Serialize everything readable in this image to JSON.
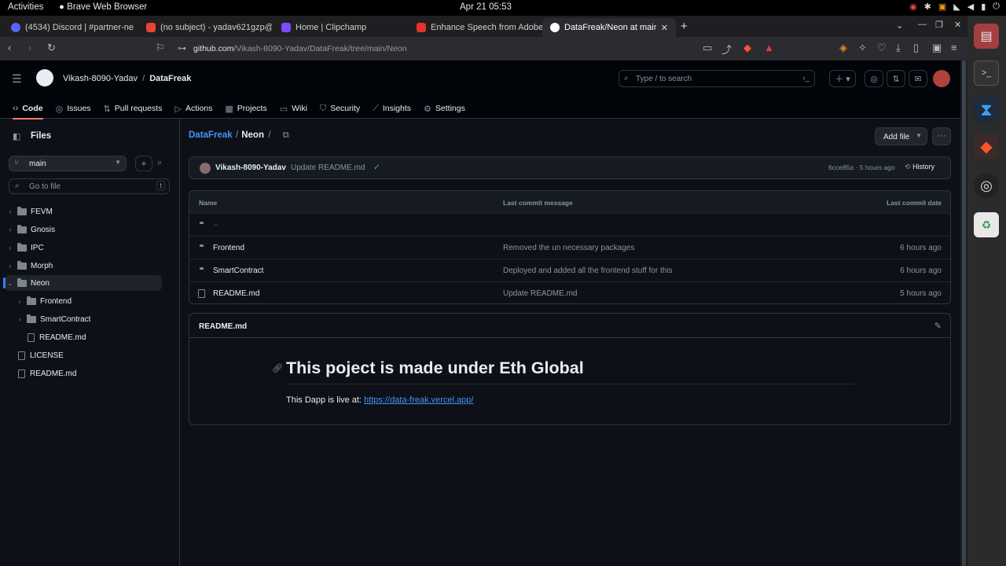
{
  "os": {
    "activities": "Activities",
    "app_name": "Brave Web Browser",
    "clock": "Apr 21  05:53"
  },
  "browser": {
    "tabs": [
      {
        "label": "(4534) Discord | #partner-ne",
        "icon_color": "#5865f2"
      },
      {
        "label": "(no subject) - yadav621gzp@",
        "icon_color": "#ea4335"
      },
      {
        "label": "Home | Clipchamp",
        "icon_color": "#7c4dff"
      },
      {
        "label": "Enhance Speech from Adobe",
        "icon_color": "#e5322d"
      },
      {
        "label": "DataFreak/Neon at main",
        "icon_color": "#ffffff"
      }
    ],
    "url_host": "github.com",
    "url_path": "/Vikash-8090-Yadav/DataFreak/tree/main/Neon"
  },
  "github": {
    "owner": "Vikash-8090-Yadav",
    "separator": "/",
    "repo": "DataFreak",
    "search_placeholder": "Type / to search",
    "nav": [
      {
        "label": "Code",
        "icon": "code-icon"
      },
      {
        "label": "Issues",
        "icon": "issue-icon"
      },
      {
        "label": "Pull requests",
        "icon": "pr-icon"
      },
      {
        "label": "Actions",
        "icon": "play-icon"
      },
      {
        "label": "Projects",
        "icon": "table-icon"
      },
      {
        "label": "Wiki",
        "icon": "book-icon"
      },
      {
        "label": "Security",
        "icon": "shield-icon"
      },
      {
        "label": "Insights",
        "icon": "graph-icon"
      },
      {
        "label": "Settings",
        "icon": "gear-icon"
      }
    ]
  },
  "sidebar": {
    "title": "Files",
    "branch": "main",
    "go_to_file": "Go to file",
    "shortcut": "t",
    "tree": [
      {
        "label": "FEVM",
        "type": "folder",
        "depth": 0
      },
      {
        "label": "Gnosis",
        "type": "folder",
        "depth": 0
      },
      {
        "label": "IPC",
        "type": "folder",
        "depth": 0
      },
      {
        "label": "Morph",
        "type": "folder",
        "depth": 0
      },
      {
        "label": "Neon",
        "type": "folder",
        "depth": 0
      },
      {
        "label": "Frontend",
        "type": "folder",
        "depth": 1
      },
      {
        "label": "SmartContract",
        "type": "folder",
        "depth": 1
      },
      {
        "label": "README.md",
        "type": "file",
        "depth": 1
      },
      {
        "label": "LICENSE",
        "type": "file",
        "depth": 0
      },
      {
        "label": "README.md",
        "type": "file",
        "depth": 0
      }
    ]
  },
  "main": {
    "breadcrumb_repo": "DataFreak",
    "breadcrumb_dir": "Neon",
    "breadcrumb_sep": "/",
    "add_file": "Add file",
    "commit": {
      "author": "Vikash-8090-Yadav",
      "message": "Update README.md",
      "sha": "6cce85a",
      "dot": "·",
      "time": "5 hours ago",
      "history": "History"
    },
    "table": {
      "headers": [
        "Name",
        "Last commit message",
        "Last commit date"
      ],
      "parent": "..",
      "rows": [
        {
          "name": "Frontend",
          "type": "folder",
          "message": "Removed the un necessary packages",
          "date": "6 hours ago"
        },
        {
          "name": "SmartContract",
          "type": "folder",
          "message": "Deployed and added all the frontend stuff for this",
          "date": "6 hours ago"
        },
        {
          "name": "README.md",
          "type": "file",
          "message": "Update README.md",
          "date": "5 hours ago"
        }
      ]
    },
    "readme": {
      "filename": "README.md",
      "heading": "This poject is made under Eth Global",
      "live_prefix": "This Dapp is live at: ",
      "live_link": "https://data-freak.vercel.app/"
    }
  },
  "colors": {
    "accent_link": "#4493f8",
    "tab_underline": "#f78166",
    "success": "#3fb950"
  }
}
